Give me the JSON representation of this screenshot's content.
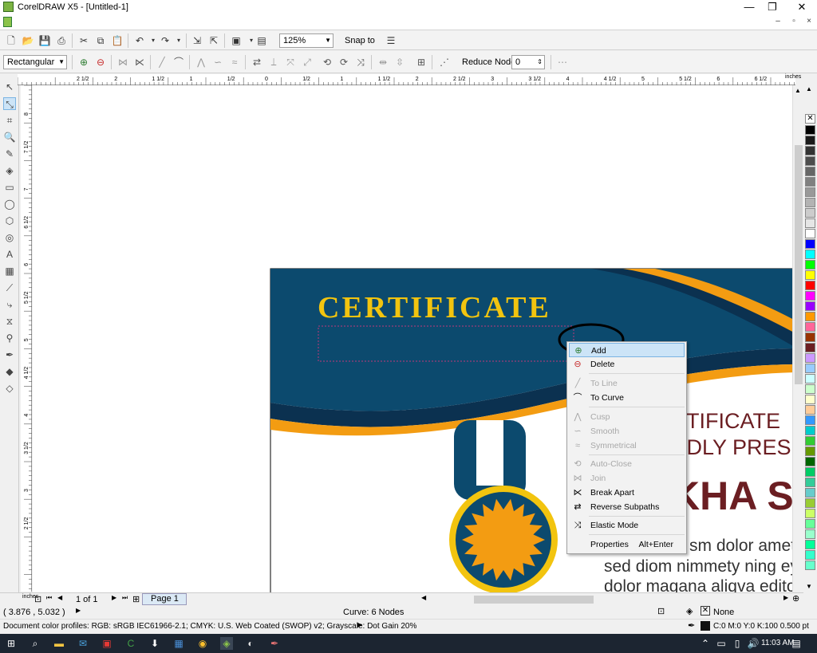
{
  "window": {
    "title": "CorelDRAW X5 - [Untitled-1]"
  },
  "toolbar": {
    "zoom": "125%",
    "snap_to": "Snap to"
  },
  "propertybar": {
    "shape_type": "Rectangular",
    "reduce_nodes_label": "Reduce Nodes",
    "reduce_nodes_value": "0"
  },
  "ruler": {
    "units": "inches",
    "h_labels": [
      "2 1/2",
      "2",
      "1 1/2",
      "1",
      "1/2",
      "0",
      "1/2",
      "1",
      "1 1/2",
      "2",
      "2 1/2",
      "3",
      "3 1/2",
      "4",
      "4 1/2",
      "5",
      "5 1/2",
      "6",
      "6 1/2"
    ],
    "v_labels": [
      "8",
      "7 1/2",
      "7",
      "6 1/2",
      "6",
      "5 1/2",
      "5",
      "4 1/2",
      "4",
      "3 1/2",
      "3",
      "2 1/2"
    ],
    "v_units": "inches"
  },
  "certificate": {
    "heading": "CERTIFICATE",
    "line1": "RTIFICATE",
    "line2": "UDLY PRES",
    "name": "KHA S",
    "body1": "sm dolor amet,",
    "body2": "sed diom nimmety ning ey",
    "body3": "dolor magana aliqva edito"
  },
  "context_menu": {
    "items": [
      {
        "label": "Add",
        "icon": "add-node-icon"
      },
      {
        "label": "Delete",
        "icon": "delete-node-icon"
      },
      {
        "label": "To Line",
        "icon": "to-line-icon"
      },
      {
        "label": "To Curve",
        "icon": "to-curve-icon"
      },
      {
        "label": "Cusp",
        "icon": "cusp-icon"
      },
      {
        "label": "Smooth",
        "icon": "smooth-icon"
      },
      {
        "label": "Symmetrical",
        "icon": "symmetrical-icon"
      },
      {
        "label": "Auto-Close",
        "icon": "auto-close-icon"
      },
      {
        "label": "Join",
        "icon": "join-icon"
      },
      {
        "label": "Break Apart",
        "icon": "break-apart-icon"
      },
      {
        "label": "Reverse Subpaths",
        "icon": "reverse-subpaths-icon"
      },
      {
        "label": "Elastic Mode",
        "icon": "elastic-mode-icon"
      },
      {
        "label": "Properties",
        "icon": "",
        "shortcut": "Alt+Enter"
      }
    ]
  },
  "page_nav": {
    "page_count": "1 of 1",
    "page_tab": "Page 1"
  },
  "status": {
    "coords": "( 3.876 , 5.032 )",
    "selection": "Curve: 6 Nodes",
    "color_profiles": "Document color profiles: RGB: sRGB IEC61966-2.1; CMYK: U.S. Web Coated (SWOP) v2; Grayscale: Dot Gain 20%",
    "fill": "None",
    "outline": "C:0 M:0 Y:0 K:100  0.500 pt"
  },
  "taskbar": {
    "time": "11:03 AM"
  },
  "colors": {
    "cert_blue": "#0c4a6e",
    "cert_gold": "#f2c40f",
    "cert_orange": "#f39c12",
    "cert_maroon": "#6b1e22",
    "highlight": "#cce4f7"
  }
}
